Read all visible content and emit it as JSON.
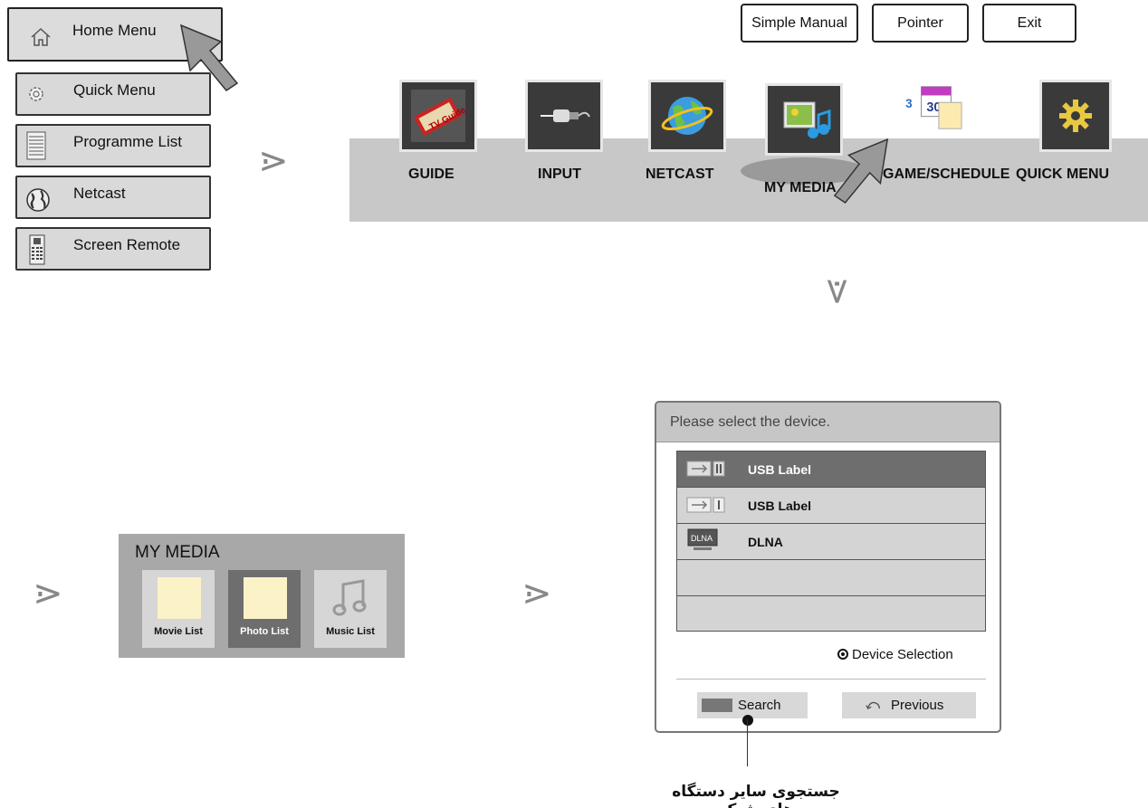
{
  "home_menu": {
    "items": [
      {
        "label": "Home Menu",
        "icon": "home-icon"
      },
      {
        "label": "Quick Menu",
        "icon": "gear-icon"
      },
      {
        "label": "Programme List",
        "icon": "list-icon"
      },
      {
        "label": "Netcast",
        "icon": "globe-icon"
      },
      {
        "label": "Screen Remote",
        "icon": "remote-icon"
      }
    ]
  },
  "top_buttons": {
    "simple_manual": "Simple Manual",
    "pointer": "Pointer",
    "exit": "Exit"
  },
  "launcher": {
    "items": [
      {
        "label": "GUIDE",
        "icon": "tv-guide-icon"
      },
      {
        "label": "INPUT",
        "icon": "input-plug-icon"
      },
      {
        "label": "NETCAST",
        "icon": "netcast-globe-icon"
      },
      {
        "label": "MY MEDIA",
        "icon": "my-media-icon"
      },
      {
        "label": "GAME/SCHEDULE",
        "icon": "calendar-icon"
      },
      {
        "label": "QUICK MENU",
        "icon": "gear-icon"
      }
    ]
  },
  "my_media": {
    "title": "MY MEDIA",
    "cards": [
      {
        "label": "Movie List",
        "icon": "movie-thumb-icon"
      },
      {
        "label": "Photo List",
        "icon": "photo-thumb-icon"
      },
      {
        "label": "Music List",
        "icon": "music-note-icon"
      }
    ]
  },
  "device_dialog": {
    "title": "Please select the device.",
    "devices": [
      {
        "label": "USB Label",
        "icon": "usb-icon"
      },
      {
        "label": "USB Label",
        "icon": "usb-icon"
      },
      {
        "label": "DLNA",
        "icon": "dlna-icon"
      }
    ],
    "hint": "Device Selection",
    "search_label": "Search",
    "previous_label": "Previous"
  },
  "callout": {
    "text": "جستجوی سایر دستگاه های شبکه"
  },
  "colors": {
    "panel_gray": "#c8c8c8",
    "tile_dark": "#3a3a3a",
    "selected_row": "#6e6e6e",
    "thumb_yellow": "#fbf3c7"
  }
}
